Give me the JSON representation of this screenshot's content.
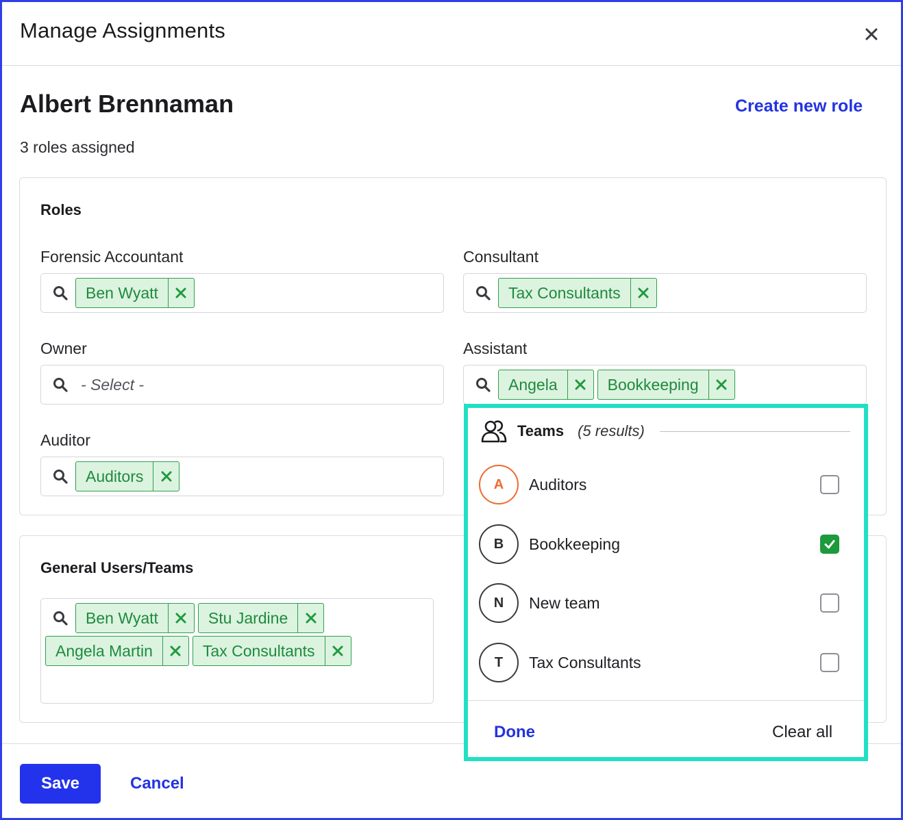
{
  "dialog": {
    "title": "Manage Assignments",
    "person_name": "Albert Brennaman",
    "create_role_label": "Create new role",
    "roles_count_text": "3 roles assigned"
  },
  "roles_section": {
    "title": "Roles",
    "fields": {
      "forensic_accountant": {
        "label": "Forensic Accountant",
        "chips": [
          "Ben Wyatt"
        ]
      },
      "consultant": {
        "label": "Consultant",
        "chips": [
          "Tax Consultants"
        ]
      },
      "owner": {
        "label": "Owner",
        "placeholder": "- Select -"
      },
      "assistant": {
        "label": "Assistant",
        "chips": [
          "Angela",
          "Bookkeeping"
        ]
      },
      "auditor": {
        "label": "Auditor",
        "chips": [
          "Auditors"
        ]
      }
    }
  },
  "general_section": {
    "title": "General Users/Teams",
    "chips": [
      "Ben Wyatt",
      "Stu Jardine",
      "Angela Martin",
      "Tax Consultants"
    ]
  },
  "dropdown": {
    "group_title": "Teams",
    "results_text": "(5 results)",
    "items": [
      {
        "initial": "A",
        "label": "Auditors",
        "checked": false
      },
      {
        "initial": "B",
        "label": "Bookkeeping",
        "checked": true
      },
      {
        "initial": "N",
        "label": "New team",
        "checked": false
      },
      {
        "initial": "T",
        "label": "Tax Consultants",
        "checked": false
      }
    ],
    "done_label": "Done",
    "clear_label": "Clear all"
  },
  "footer": {
    "save_label": "Save",
    "cancel_label": "Cancel"
  },
  "colors": {
    "accent": "#2333ec",
    "chip_bg": "#dcf3df",
    "chip_text": "#1e8a3e",
    "dropdown_highlight": "#20e0c4",
    "avatar_orange": "#ee6a2e",
    "checkbox_checked": "#1c9a3c"
  },
  "icons": {
    "close": "close-icon",
    "search": "search-icon",
    "chip_remove": "remove-x-icon",
    "teams": "users-group-icon",
    "check": "checkmark-icon"
  }
}
